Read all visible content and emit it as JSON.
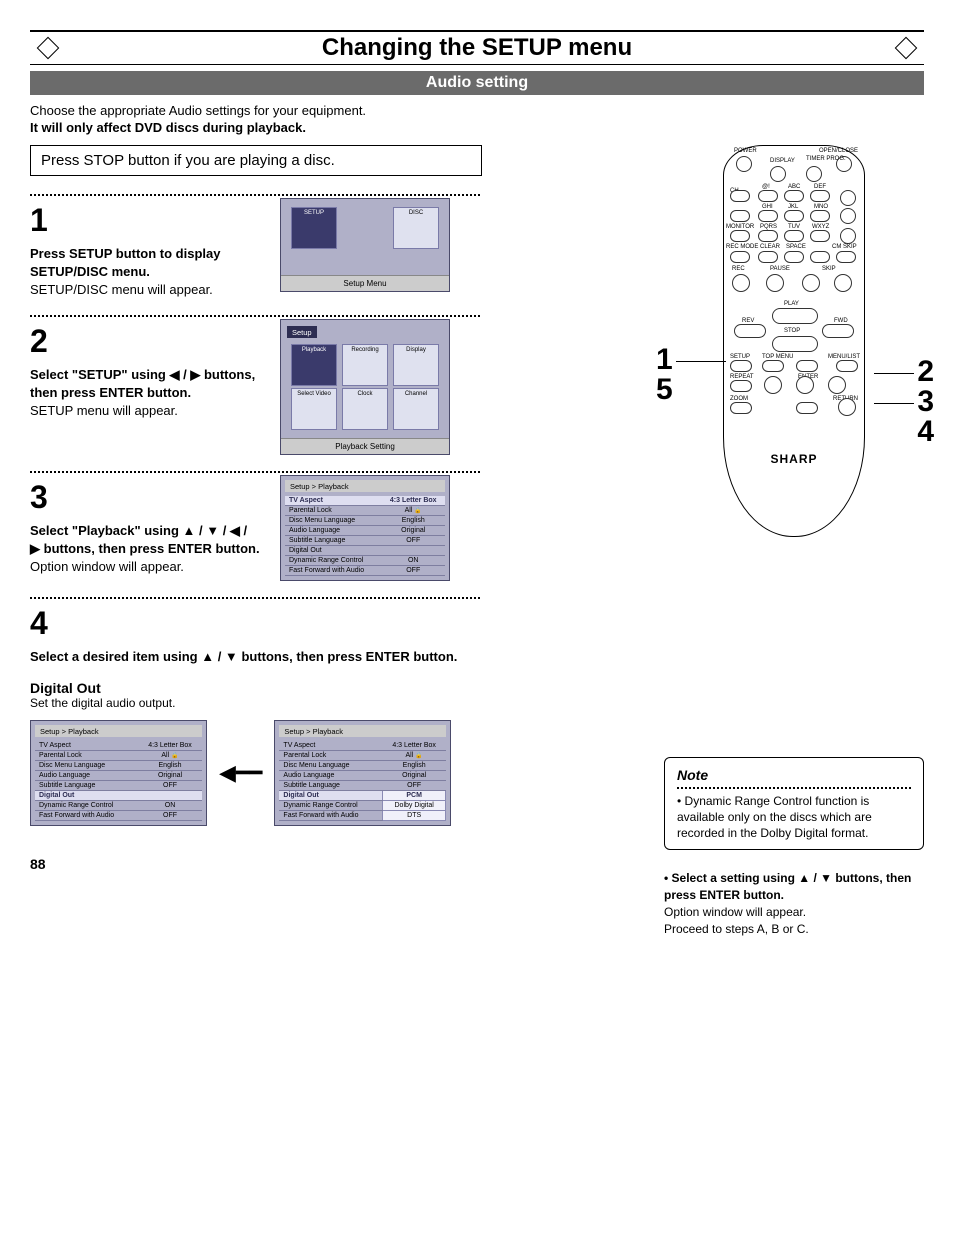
{
  "title": "Changing the SETUP menu",
  "subtitle": "Audio setting",
  "intro_line1": "Choose the appropriate Audio settings for your equipment.",
  "intro_line2": "It will only affect DVD discs during playback.",
  "stop_box": "Press STOP button if you are playing a disc.",
  "steps": {
    "s1": {
      "num": "1",
      "bold": "Press SETUP button to display SETUP/DISC menu.",
      "plain": "SETUP/DISC menu will appear.",
      "caption": "Setup Menu",
      "tiles": [
        "SETUP",
        "DISC"
      ]
    },
    "s2": {
      "num": "2",
      "bold_pre": "Select \"SETUP\" using ",
      "bold_post": " buttons, then press ENTER button.",
      "arrows": "◀ / ▶",
      "plain": "SETUP menu will appear.",
      "caption": "Playback Setting",
      "mock_title": "Setup",
      "tiles_top": [
        "Playback",
        "Recording",
        "Display"
      ],
      "tiles_bot": [
        "Select Video",
        "Clock",
        "Channel"
      ]
    },
    "s3": {
      "num": "3",
      "bold_pre": "Select \"Playback\" using ",
      "bold_post": " buttons, then press ENTER button.",
      "arrows": "▲ / ▼ / ◀ / ▶",
      "plain": "Option window will appear.",
      "breadcrumb": "Setup > Playback",
      "rows": [
        [
          "TV Aspect",
          "4:3 Letter Box"
        ],
        [
          "Parental Lock",
          "All"
        ],
        [
          "Disc Menu Language",
          "English"
        ],
        [
          "Audio Language",
          "Original"
        ],
        [
          "Subtitle Language",
          "OFF"
        ],
        [
          "Digital Out",
          ""
        ],
        [
          "Dynamic Range Control",
          "ON"
        ],
        [
          "Fast Forward with Audio",
          "OFF"
        ]
      ]
    },
    "s4": {
      "num": "4",
      "bold_pre": "Select a desired item using ",
      "bold_post": " buttons, then press ENTER button.",
      "arrows": "▲ / ▼"
    }
  },
  "digital_out": {
    "heading": "Digital Out",
    "text": "Set the digital audio output.",
    "breadcrumb": "Setup > Playback",
    "left_rows": [
      [
        "TV Aspect",
        "4:3 Letter Box"
      ],
      [
        "Parental Lock",
        "All"
      ],
      [
        "Disc Menu Language",
        "English"
      ],
      [
        "Audio Language",
        "Original"
      ],
      [
        "Subtitle Language",
        "OFF"
      ],
      [
        "Digital Out",
        ""
      ],
      [
        "Dynamic Range Control",
        "ON"
      ],
      [
        "Fast Forward with Audio",
        "OFF"
      ]
    ],
    "right_rows": [
      [
        "TV Aspect",
        "4:3 Letter Box"
      ],
      [
        "Parental Lock",
        "All"
      ],
      [
        "Disc Menu Language",
        "English"
      ],
      [
        "Audio Language",
        "Original"
      ],
      [
        "Subtitle Language",
        "OFF"
      ],
      [
        "Digital Out",
        "PCM"
      ],
      [
        "Dynamic Range Control",
        "Dolby Digital"
      ],
      [
        "Fast Forward with Audio",
        "DTS"
      ]
    ]
  },
  "remote": {
    "brand": "SHARP",
    "labels": {
      "power": "POWER",
      "open": "OPEN/CLOSE",
      "display": "DISPLAY",
      "timer": "TIMER PROG.",
      "ch": "CH",
      "recmode": "REC MODE",
      "clear": "CLEAR",
      "space": "SPACE",
      "cmskip": "CM SKIP",
      "rec": "REC",
      "pause": "PAUSE",
      "skip": "SKIP",
      "rev": "REV",
      "play": "PLAY",
      "fwd": "FWD",
      "stop": "STOP",
      "setup": "SETUP",
      "topmenu": "TOP MENU",
      "menulist": "MENU/LIST",
      "repeat": "REPEAT",
      "enter": "ENTER",
      "return": "RETURN",
      "zoom": "ZOOM",
      "d1": "@!",
      "d2": "ABC",
      "d3": "DEF",
      "d4": "GHI",
      "d5": "JKL",
      "d6": "MNO",
      "d7": "PQRS",
      "d8": "TUV",
      "d9": "WXYZ",
      "d0": "MONITOR"
    },
    "callouts": {
      "left1": "1",
      "left2": "5",
      "right1": "2",
      "right2": "3",
      "right3": "4"
    }
  },
  "note": {
    "head": "Note",
    "body": "Dynamic Range Control function is available only on the discs which are recorded in the Dolby Digital format."
  },
  "right_tail": {
    "bold_pre": "• Select a setting using ",
    "arrows": "▲ / ▼",
    "bold_post": " buttons, then press ENTER button.",
    "l1": "Option window will appear.",
    "l2": "Proceed to steps A, B or C."
  },
  "page": "88"
}
